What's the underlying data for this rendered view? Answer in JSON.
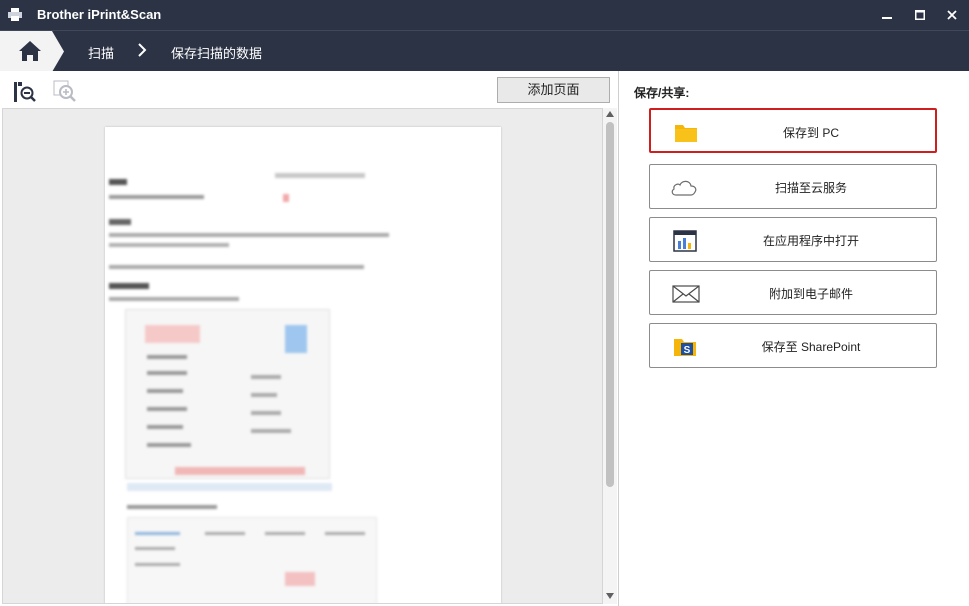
{
  "window": {
    "title": "Brother iPrint&Scan",
    "controls": [
      "minimize",
      "maximize",
      "close"
    ]
  },
  "breadcrumb": {
    "home_icon": "home-icon",
    "items": [
      "扫描",
      "保存扫描的数据"
    ]
  },
  "toolbar": {
    "fit_icon": "fit-page-icon",
    "zoom_icon": "zoom-in-icon",
    "add_page_label": "添加页面"
  },
  "share": {
    "label": "保存/共享:",
    "actions": [
      {
        "label": "保存到 PC",
        "icon": "folder-icon",
        "selected": true
      },
      {
        "label": "扫描至云服务",
        "icon": "cloud-icon",
        "selected": false
      },
      {
        "label": "在应用程序中打开",
        "icon": "application-icon",
        "selected": false
      },
      {
        "label": "附加到电子邮件",
        "icon": "envelope-icon",
        "selected": false
      },
      {
        "label": "保存至 SharePoint",
        "icon": "sharepoint-icon",
        "selected": false
      }
    ]
  },
  "colors": {
    "title_bar": "#2c3345",
    "selected_border": "#d01e1e",
    "folder": "#f5b50a"
  }
}
